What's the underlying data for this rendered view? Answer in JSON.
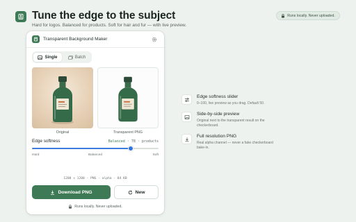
{
  "header": {
    "headline": "Tune the edge to the subject",
    "subline": "Hard for logos. Balanced for products. Soft for hair and fur — with live preview.",
    "badge": "Runs locally. Never uploaded."
  },
  "app": {
    "title": "Transparent Background Maker",
    "tabs": [
      {
        "label": "Single",
        "active": true
      },
      {
        "label": "Batch",
        "active": false
      }
    ],
    "previews": {
      "original_label": "Original",
      "transparent_label": "Transparent PNG"
    },
    "edge": {
      "label": "Edge softness",
      "mode": "Balanced",
      "sep1": "·",
      "value_text": "78",
      "sep2": "·",
      "context": "products",
      "value": 78,
      "min": 0,
      "max": 100,
      "ticks": [
        "Hard",
        "Balanced",
        "Soft"
      ]
    },
    "meta": "1200 × 1200 · PNG · alpha · 84 KB",
    "download_label": "Download PNG",
    "new_label": "New",
    "footer": "Runs locally. Never uploaded."
  },
  "features": [
    {
      "icon": "sliders-icon",
      "title": "Edge softness slider",
      "desc": "0–100, live preview as you drag. Default 50."
    },
    {
      "icon": "image-icon",
      "title": "Side-by-side preview",
      "desc": "Original next to the transparent result on the checkerboard."
    },
    {
      "icon": "download-icon",
      "title": "Full resolution PNG",
      "desc": "Real alpha channel — never a fake checkerboard bake-in."
    }
  ],
  "colors": {
    "accent": "#3e7a55",
    "slider": "#2f73e6",
    "background": "#eef2ee"
  }
}
